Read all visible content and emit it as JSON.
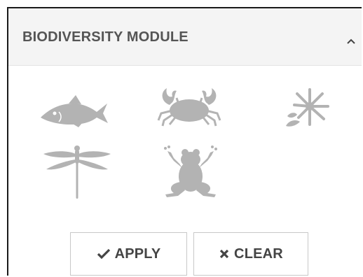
{
  "panel": {
    "title": "BIODIVERSITY MODULE",
    "toggle_icon": "chevron-up-icon"
  },
  "taxa": [
    {
      "icon": "fish-icon"
    },
    {
      "icon": "crab-icon"
    },
    {
      "icon": "plant-icon"
    },
    {
      "icon": "dragonfly-icon"
    },
    {
      "icon": "frog-icon"
    }
  ],
  "actions": {
    "apply_label": "APPLY",
    "apply_icon": "checkmark-icon",
    "clear_label": "CLEAR",
    "clear_icon": "x-icon"
  },
  "colors": {
    "icon_gray": "#b3b3b3",
    "text_gray": "#555555",
    "header_bg": "#f4f4f4"
  }
}
